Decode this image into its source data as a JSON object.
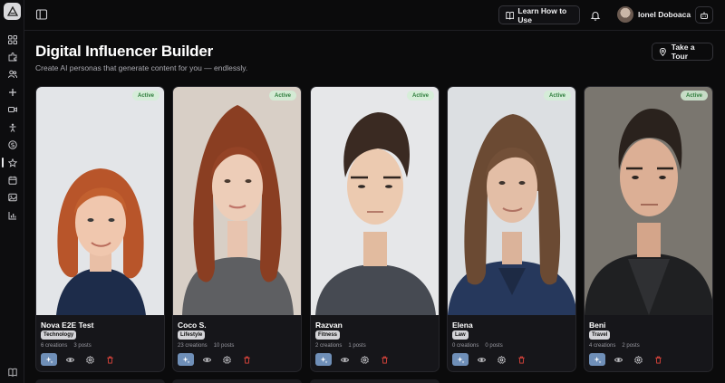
{
  "header": {
    "learn_label": "Learn How to Use",
    "user_name": "Ionel Doboaca"
  },
  "page": {
    "title": "Digital Influencer Builder",
    "subtitle": "Create AI personas that generate content for you — endlessly.",
    "tour_label": "Take a Tour"
  },
  "cards": [
    {
      "name": "Nova E2E Test",
      "category": "Technology",
      "creations": "6 creations",
      "posts": "3 posts",
      "status": "Active"
    },
    {
      "name": "Coco S.",
      "category": "Lifestyle",
      "creations": "23 creations",
      "posts": "10 posts",
      "status": "Active"
    },
    {
      "name": "Razvan",
      "category": "Fitness",
      "creations": "2 creations",
      "posts": "1 posts",
      "status": "Active"
    },
    {
      "name": "Elena",
      "category": "Law",
      "creations": "0 creations",
      "posts": "0 posts",
      "status": "Active"
    },
    {
      "name": "Beni",
      "category": "Travel",
      "creations": "4 creations",
      "posts": "2 posts",
      "status": "Active"
    }
  ],
  "colors": {
    "background": "#0b0b0c",
    "card": "#16161a",
    "primary_action": "#6f8fb8",
    "danger": "#e0453c",
    "active_badge_bg": "#d4eed6",
    "active_badge_text": "#2e7d3c"
  }
}
